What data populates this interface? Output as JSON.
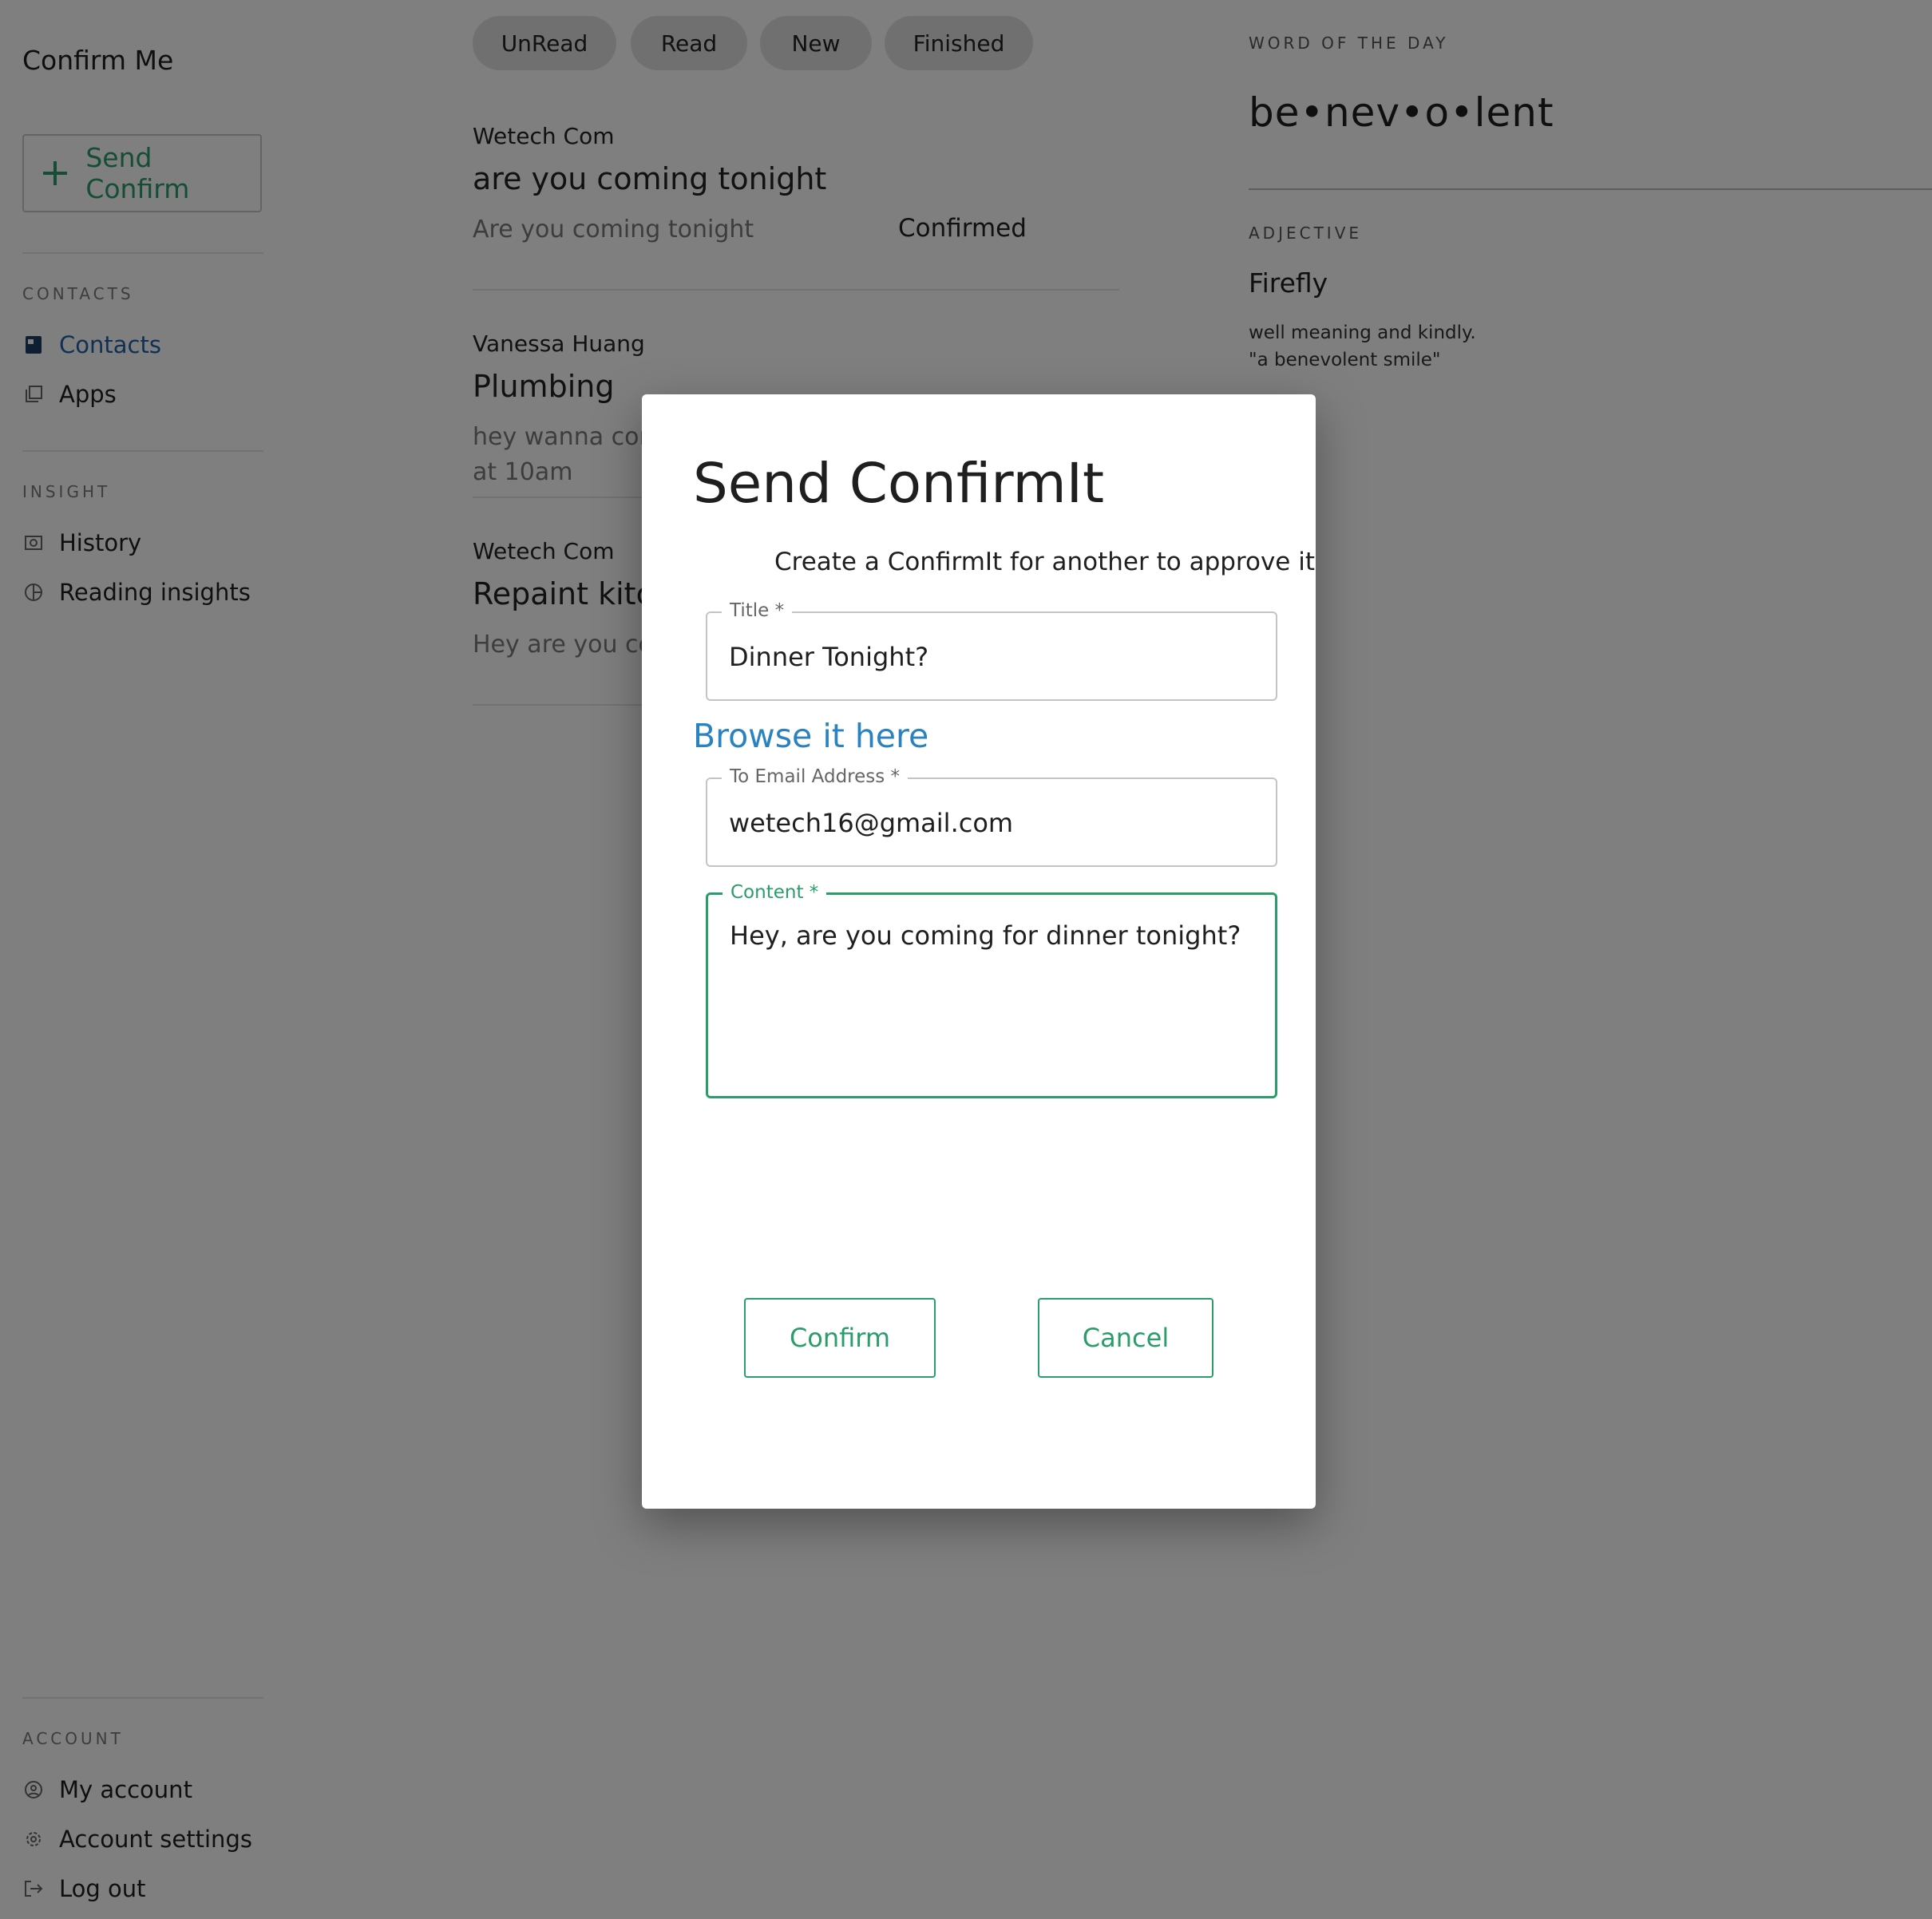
{
  "sidebar": {
    "app_title": "Confirm Me",
    "send_button": "Send Confirm",
    "contacts_section": "CONTACTS",
    "insight_section": "INSIGHT",
    "account_section": "ACCOUNT",
    "items": {
      "contacts": "Contacts",
      "apps": "Apps",
      "history": "History",
      "reading_insights": "Reading insights",
      "my_account": "My account",
      "account_settings": "Account settings",
      "log_out": "Log out"
    },
    "active_item": "Contacts",
    "accent_color": "#1e63a6"
  },
  "tabs": [
    "UnRead",
    "Read",
    "New",
    "Finished"
  ],
  "messages": [
    {
      "sender": "Wetech Com",
      "title": "are you coming tonight",
      "preview": "Are you coming tonight",
      "status": "Confirmed"
    },
    {
      "sender": "Vanessa Huang",
      "title": "Plumbing",
      "preview_line1": "hey wanna com",
      "preview_line2": "at 10am"
    },
    {
      "sender": "Wetech Com",
      "title": "Repaint kitch",
      "preview": "Hey are you co"
    }
  ],
  "word_of_the_day": {
    "label": "WORD OF THE DAY",
    "word": "be•nev•o•lent",
    "part_of_speech": "ADJECTIVE",
    "name": "Firefly",
    "definition": "well meaning and kindly.",
    "example": "\"a benevolent smile\""
  },
  "dialog": {
    "title": "Send ConfirmIt",
    "subtitle": "Create a ConfirmIt for another to approve it",
    "title_field": {
      "label": "Title *",
      "value": "Dinner Tonight?"
    },
    "browse_link": "Browse it here",
    "email_field": {
      "label": "To Email Address *",
      "value": "wetech16@gmail.com"
    },
    "content_field": {
      "label": "Content *",
      "value": "Hey, are you coming for dinner tonight?"
    },
    "confirm_button": "Confirm",
    "cancel_button": "Cancel",
    "accent_color": "#2a9d6a",
    "link_color": "#2a83c0"
  }
}
